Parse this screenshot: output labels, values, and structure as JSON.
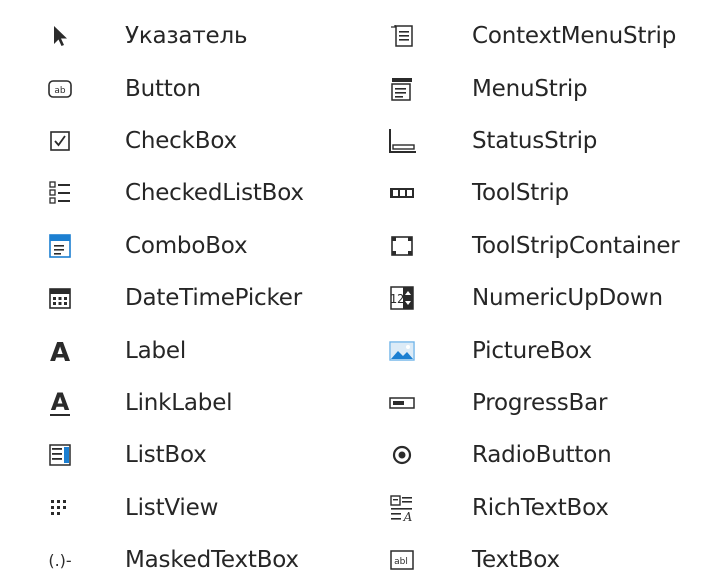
{
  "toolbox": {
    "left_column": [
      {
        "label": "Указатель",
        "icon": "pointer-icon"
      },
      {
        "label": "Button",
        "icon": "button-icon"
      },
      {
        "label": "CheckBox",
        "icon": "checkbox-icon"
      },
      {
        "label": "CheckedListBox",
        "icon": "checked-list-box-icon"
      },
      {
        "label": "ComboBox",
        "icon": "combobox-icon"
      },
      {
        "label": "DateTimePicker",
        "icon": "date-time-picker-icon"
      },
      {
        "label": "Label",
        "icon": "label-icon"
      },
      {
        "label": "LinkLabel",
        "icon": "link-label-icon"
      },
      {
        "label": "ListBox",
        "icon": "list-box-icon"
      },
      {
        "label": "ListView",
        "icon": "list-view-icon"
      },
      {
        "label": "MaskedTextBox",
        "icon": "masked-text-box-icon"
      }
    ],
    "right_column": [
      {
        "label": "ContextMenuStrip",
        "icon": "context-menu-strip-icon"
      },
      {
        "label": "MenuStrip",
        "icon": "menu-strip-icon"
      },
      {
        "label": "StatusStrip",
        "icon": "status-strip-icon"
      },
      {
        "label": "ToolStrip",
        "icon": "tool-strip-icon"
      },
      {
        "label": "ToolStripContainer",
        "icon": "tool-strip-container-icon"
      },
      {
        "label": "NumericUpDown",
        "icon": "numeric-up-down-icon"
      },
      {
        "label": "PictureBox",
        "icon": "picture-box-icon"
      },
      {
        "label": "ProgressBar",
        "icon": "progress-bar-icon"
      },
      {
        "label": "RadioButton",
        "icon": "radio-button-icon"
      },
      {
        "label": "RichTextBox",
        "icon": "rich-text-box-icon"
      },
      {
        "label": "TextBox",
        "icon": "text-box-icon"
      }
    ],
    "colors": {
      "icon_dark": "#2b2b2b",
      "icon_blue": "#1c7fd1",
      "icon_light_blue": "#6fb4e8"
    }
  }
}
